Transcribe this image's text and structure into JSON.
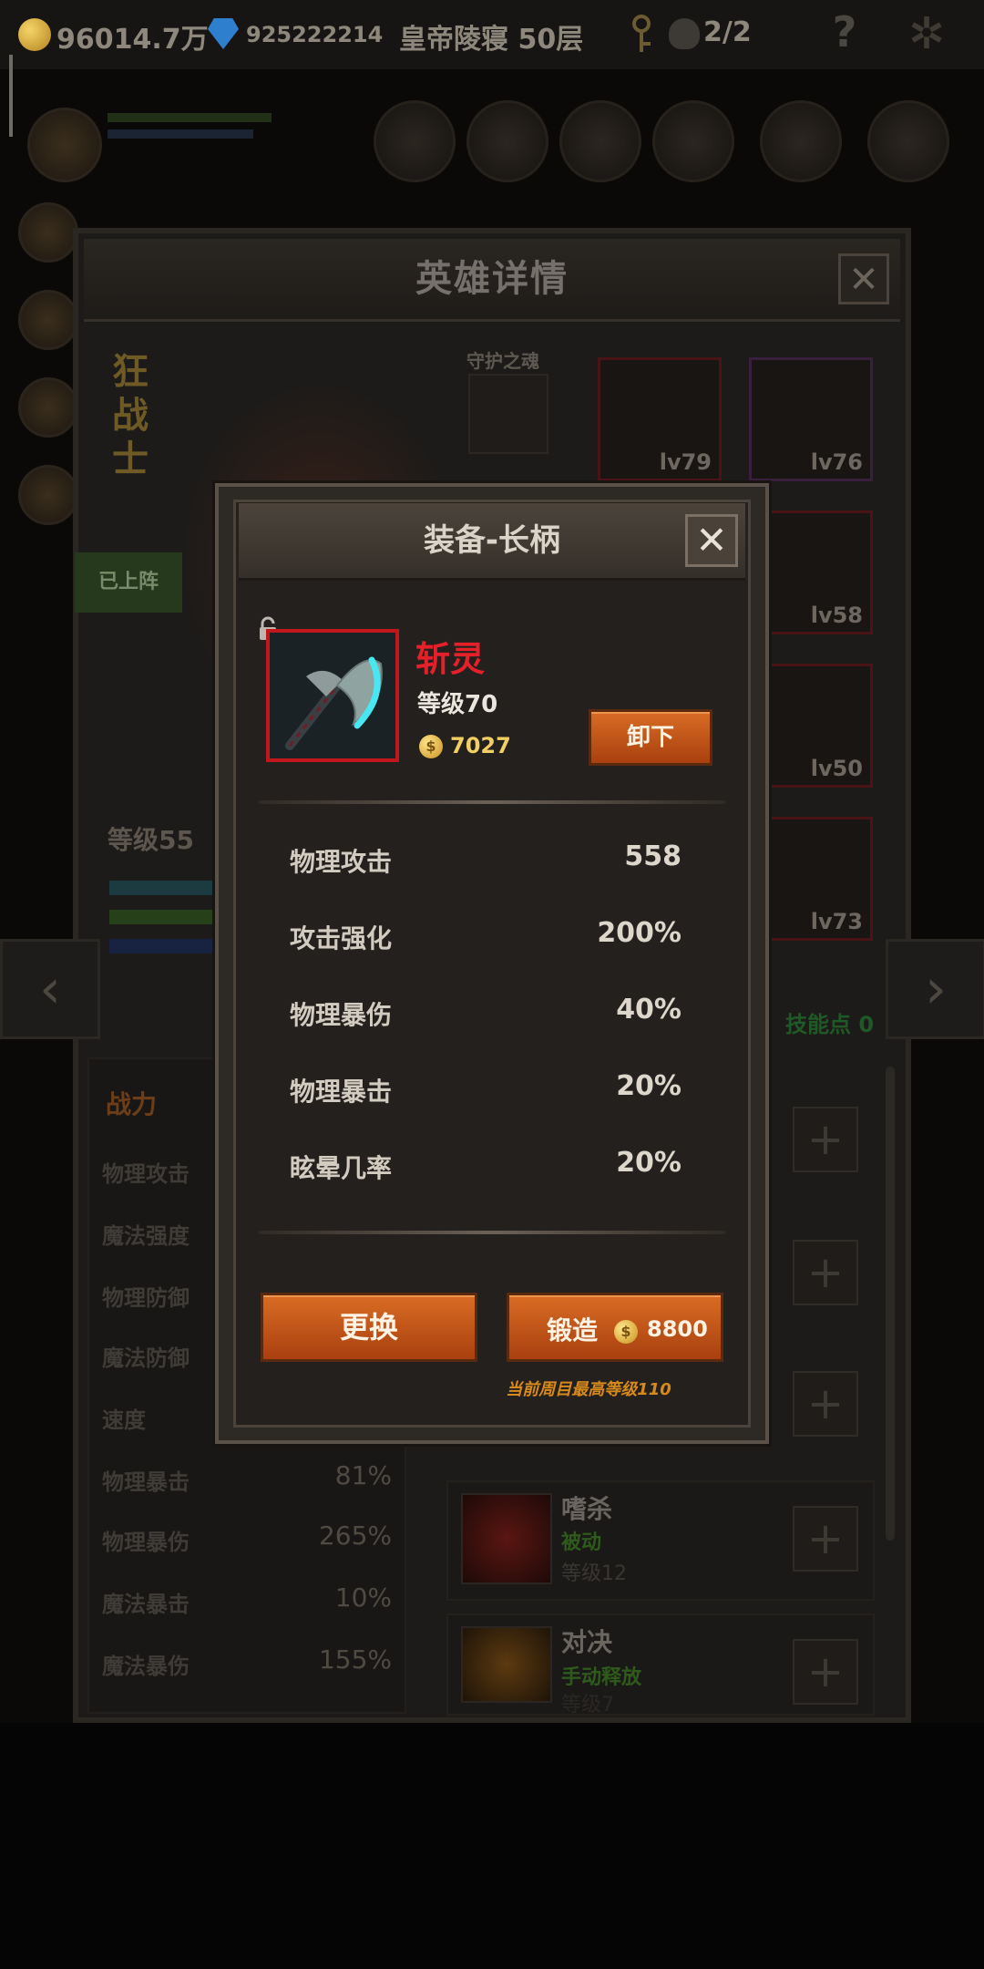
{
  "topbar": {
    "gold": "96014.7万",
    "gems": "925222214",
    "tower": "皇帝陵寝 50层",
    "keys_ratio": "2/2"
  },
  "hero_panel": {
    "title": "英雄详情",
    "class_chars": [
      "狂",
      "战",
      "士"
    ],
    "guard_label": "守护之魂",
    "deployed": "已上阵",
    "level": "等级55",
    "skill_points": "技能点 0",
    "tab_power": "战力",
    "gear_levels": [
      "lv79",
      "lv76",
      "lv58",
      "lv50",
      "lv73"
    ],
    "stats": [
      {
        "label": "物理攻击",
        "value": ""
      },
      {
        "label": "魔法强度",
        "value": ""
      },
      {
        "label": "物理防御",
        "value": ""
      },
      {
        "label": "魔法防御",
        "value": ""
      },
      {
        "label": "速度",
        "value": ""
      },
      {
        "label": "物理暴击",
        "value": "81%"
      },
      {
        "label": "物理暴伤",
        "value": "265%"
      },
      {
        "label": "魔法暴击",
        "value": "10%"
      },
      {
        "label": "魔法暴伤",
        "value": "155%"
      }
    ],
    "skills": [
      {
        "name": "嗜杀",
        "type": "被动",
        "level": "等级12"
      },
      {
        "name": "对决",
        "type": "手动释放",
        "level": "等级7"
      }
    ]
  },
  "dialog": {
    "title": "装备-长柄",
    "item": {
      "name": "斩灵",
      "level": "等级70",
      "price": "7027",
      "frame_color": "#c0161c",
      "name_color": "#e4202a"
    },
    "unequip_label": "卸下",
    "stats": [
      {
        "label": "物理攻击",
        "value": "558"
      },
      {
        "label": "攻击强化",
        "value": "200%"
      },
      {
        "label": "物理暴伤",
        "value": "40%"
      },
      {
        "label": "物理暴击",
        "value": "20%"
      },
      {
        "label": "眩晕几率",
        "value": "20%"
      }
    ],
    "replace_label": "更换",
    "forge_label": "锻造",
    "forge_cost": "8800",
    "max_level_note": "当前周目最高等级110"
  }
}
